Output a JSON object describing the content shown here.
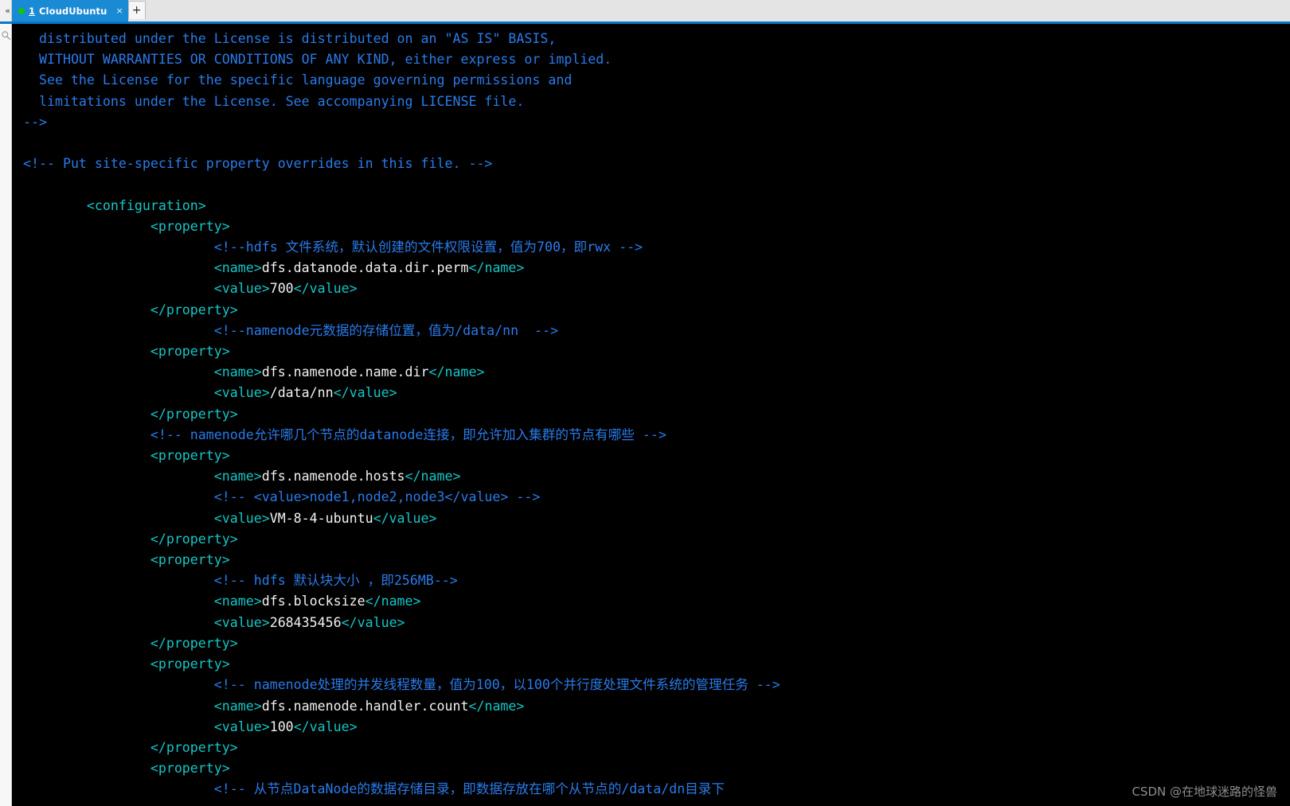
{
  "window": {
    "collapse_icon": "«",
    "search_icon": "search-icon"
  },
  "tabbar": {
    "tabs": [
      {
        "index": "1",
        "title": "CloudUbuntu",
        "status_dot_color": "#16c211",
        "close_label": "×",
        "active": true
      }
    ],
    "new_tab_label": "+"
  },
  "colors": {
    "tab_active_bg": "#1a8ad4",
    "topbar_bg": "#e4e4e4",
    "accent_border": "#0a76c4",
    "terminal_bg": "#000000",
    "comment": "#2a7bea",
    "tag": "#16c5c5",
    "text": "#f2f2f2",
    "status_dot": "#16c211"
  },
  "terminal": {
    "lines": [
      [
        {
          "t": "  distributed under the License is distributed on an \"AS IS\" BASIS,",
          "c": "cm"
        }
      ],
      [
        {
          "t": "  WITHOUT WARRANTIES OR CONDITIONS OF ANY KIND, either express or implied.",
          "c": "cm"
        }
      ],
      [
        {
          "t": "  See the License for the specific language governing permissions and",
          "c": "cm"
        }
      ],
      [
        {
          "t": "  limitations under the License. See accompanying LICENSE file.",
          "c": "cm"
        }
      ],
      [
        {
          "t": "-->",
          "c": "cm"
        }
      ],
      [],
      [
        {
          "t": "<!-- Put site-specific property overrides in this file. -->",
          "c": "cm"
        }
      ],
      [],
      [
        {
          "t": "        <configuration>",
          "c": "tg"
        }
      ],
      [
        {
          "t": "                <property>",
          "c": "tg"
        }
      ],
      [
        {
          "t": "                        <!--hdfs 文件系统，默认创建的文件权限设置，值为700，即rwx -->",
          "c": "cm"
        }
      ],
      [
        {
          "t": "                        <name>",
          "c": "tg"
        },
        {
          "t": "dfs.datanode.data.dir.perm",
          "c": "tx"
        },
        {
          "t": "</name>",
          "c": "tg"
        }
      ],
      [
        {
          "t": "                        <value>",
          "c": "tg"
        },
        {
          "t": "700",
          "c": "tx"
        },
        {
          "t": "</value>",
          "c": "tg"
        }
      ],
      [
        {
          "t": "                </property>",
          "c": "tg"
        }
      ],
      [
        {
          "t": "                        <!--namenode元数据的存储位置，值为/data/nn  -->",
          "c": "cm"
        }
      ],
      [
        {
          "t": "                <property>",
          "c": "tg"
        }
      ],
      [
        {
          "t": "                        <name>",
          "c": "tg"
        },
        {
          "t": "dfs.namenode.name.dir",
          "c": "tx"
        },
        {
          "t": "</name>",
          "c": "tg"
        }
      ],
      [
        {
          "t": "                        <value>",
          "c": "tg"
        },
        {
          "t": "/data/nn",
          "c": "tx"
        },
        {
          "t": "</value>",
          "c": "tg"
        }
      ],
      [
        {
          "t": "                </property>",
          "c": "tg"
        }
      ],
      [
        {
          "t": "                <!-- namenode允许哪几个节点的datanode连接，即允许加入集群的节点有哪些 -->",
          "c": "cm"
        }
      ],
      [
        {
          "t": "                <property>",
          "c": "tg"
        }
      ],
      [
        {
          "t": "                        <name>",
          "c": "tg"
        },
        {
          "t": "dfs.namenode.hosts",
          "c": "tx"
        },
        {
          "t": "</name>",
          "c": "tg"
        }
      ],
      [
        {
          "t": "                        <!-- <value>node1,node2,node3</value> -->",
          "c": "cm"
        }
      ],
      [
        {
          "t": "                        <value>",
          "c": "tg"
        },
        {
          "t": "VM-8-4-ubuntu",
          "c": "tx"
        },
        {
          "t": "</value>",
          "c": "tg"
        }
      ],
      [
        {
          "t": "                </property>",
          "c": "tg"
        }
      ],
      [
        {
          "t": "                <property>",
          "c": "tg"
        }
      ],
      [
        {
          "t": "                        <!-- hdfs 默认块大小 ，即256MB-->",
          "c": "cm"
        }
      ],
      [
        {
          "t": "                        <name>",
          "c": "tg"
        },
        {
          "t": "dfs.blocksize",
          "c": "tx"
        },
        {
          "t": "</name>",
          "c": "tg"
        }
      ],
      [
        {
          "t": "                        <value>",
          "c": "tg"
        },
        {
          "t": "268435456",
          "c": "tx"
        },
        {
          "t": "</value>",
          "c": "tg"
        }
      ],
      [
        {
          "t": "                </property>",
          "c": "tg"
        }
      ],
      [
        {
          "t": "                <property>",
          "c": "tg"
        }
      ],
      [
        {
          "t": "                        <!-- namenode处理的并发线程数量，值为100，以100个并行度处理文件系统的管理任务 -->",
          "c": "cm"
        }
      ],
      [
        {
          "t": "                        <name>",
          "c": "tg"
        },
        {
          "t": "dfs.namenode.handler.count",
          "c": "tx"
        },
        {
          "t": "</name>",
          "c": "tg"
        }
      ],
      [
        {
          "t": "                        <value>",
          "c": "tg"
        },
        {
          "t": "100",
          "c": "tx"
        },
        {
          "t": "</value>",
          "c": "tg"
        }
      ],
      [
        {
          "t": "                </property>",
          "c": "tg"
        }
      ],
      [
        {
          "t": "                <property>",
          "c": "tg"
        }
      ],
      [
        {
          "t": "                        <!-- 从节点DataNode的数据存储目录，即数据存放在哪个从节点的/data/dn目录下",
          "c": "cm"
        }
      ]
    ]
  },
  "watermark": {
    "text": "CSDN @在地球迷路的怪兽"
  }
}
